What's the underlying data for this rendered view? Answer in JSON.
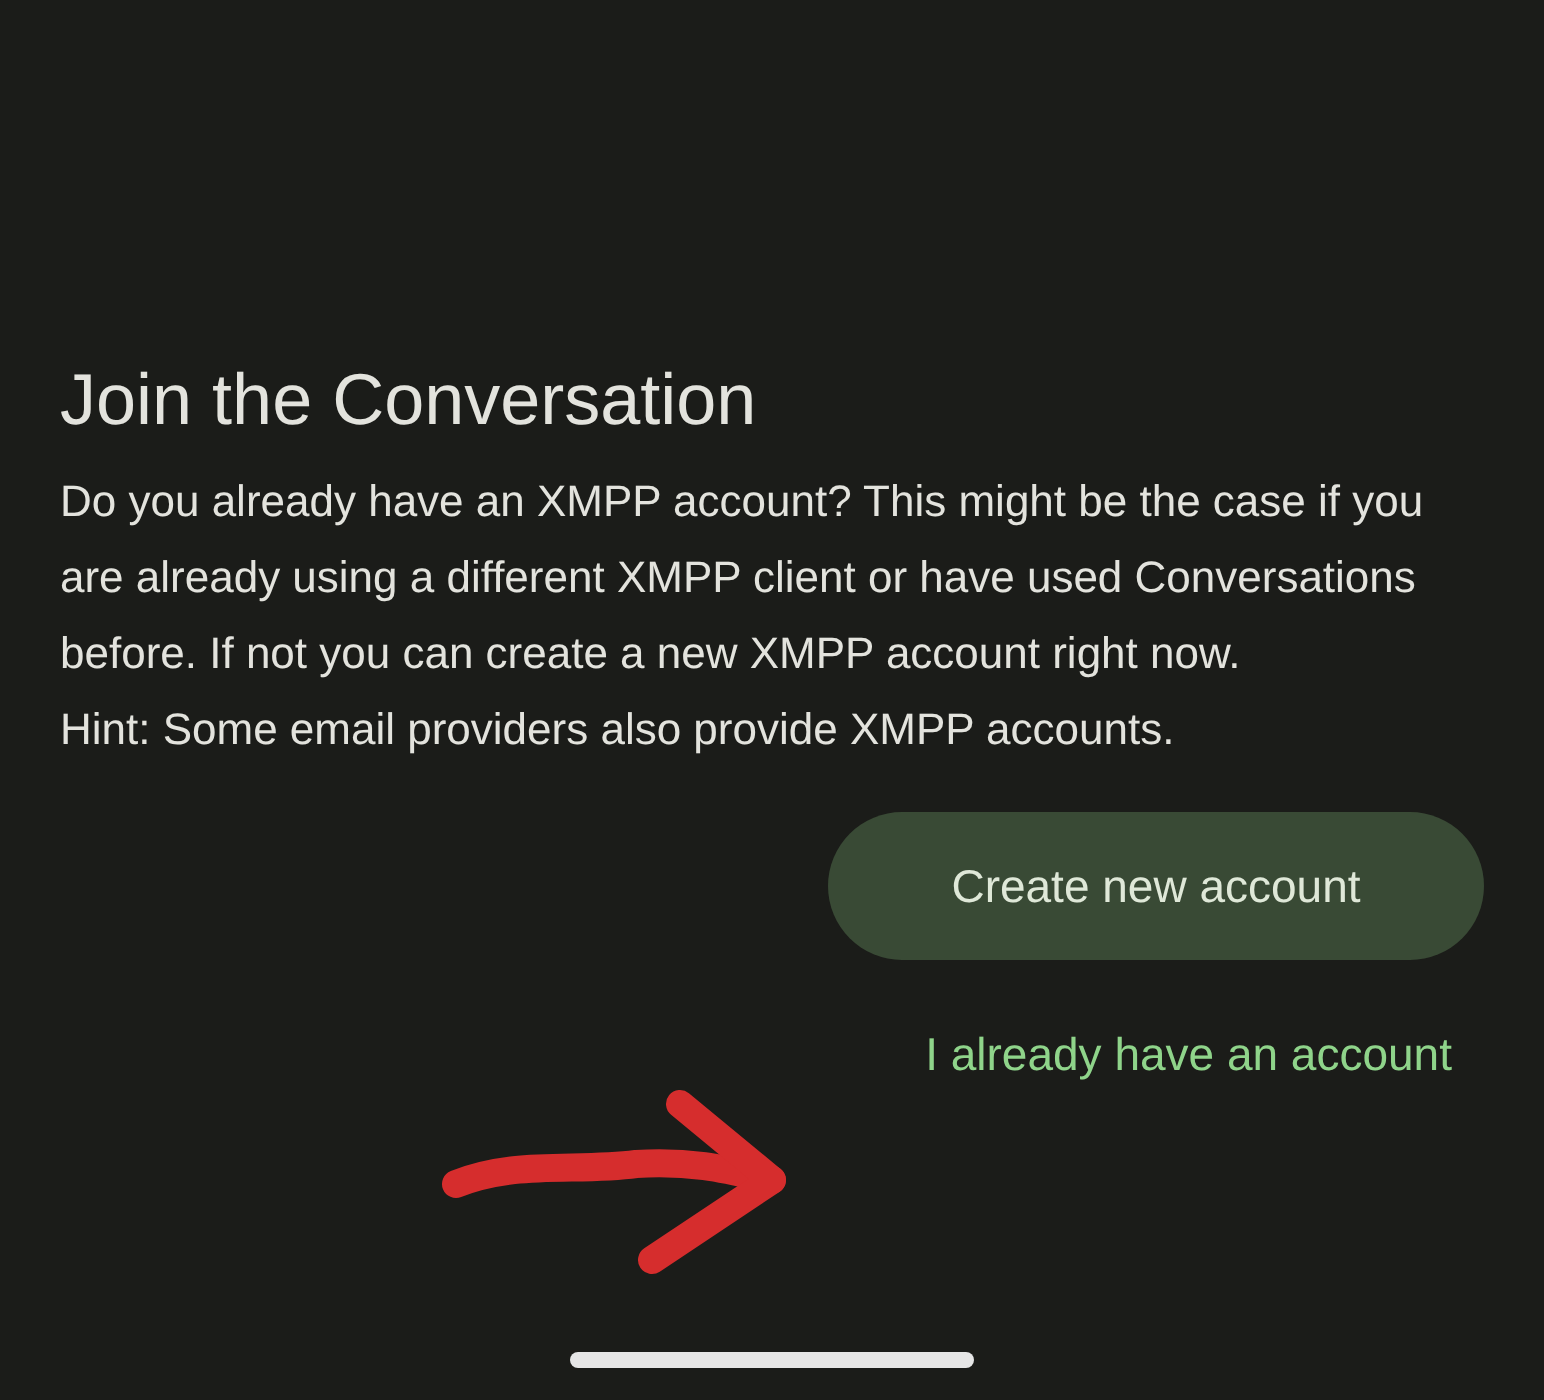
{
  "title": "Join the Conversation",
  "description": [
    "Do you already have an XMPP account? This might be the case if you are already using a different XMPP client or have used Conversations before. If not you can create a new XMPP account right now.",
    "Hint: Some email providers also provide XMPP accounts."
  ],
  "primary_button": "Create new account",
  "secondary_link": "I already have an account"
}
